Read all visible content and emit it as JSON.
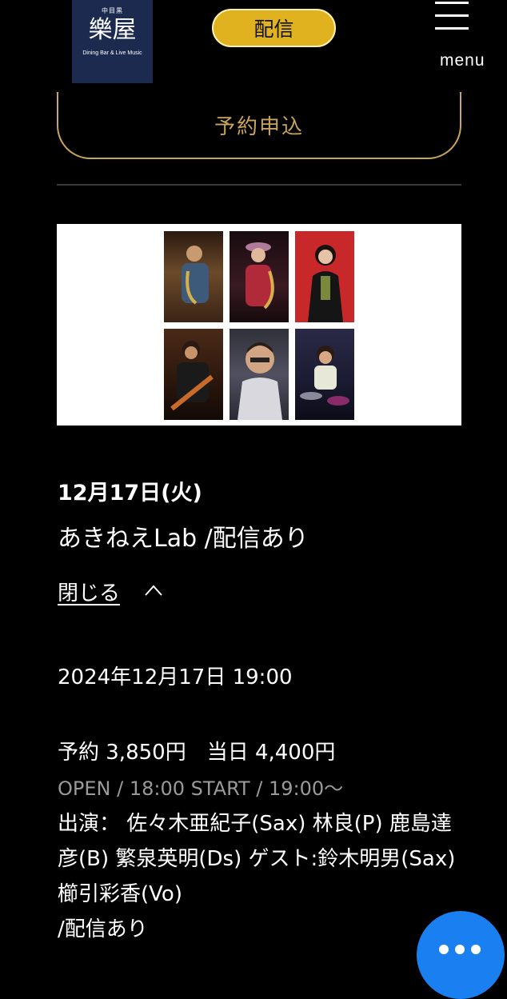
{
  "header": {
    "logo": {
      "small": "中目黒",
      "main": "樂屋",
      "subtitle": "Dining Bar & Live Music"
    },
    "stream_button_label": "配信",
    "menu_label": "menu"
  },
  "reserve_button_label": "予約申込",
  "event": {
    "date": "12月17日(火)",
    "title": "あきねえLab /配信あり",
    "close_label": "閉じる",
    "datetime": "2024年12月17日 19:00",
    "price": "予約 3,850円　当日 4,400円",
    "open_start": "OPEN / 18:00  START / 19:00〜",
    "performers": "出演： 佐々木亜紀子(Sax) 林良(P) 鹿島達彦(B) 繁泉英明(Ds) ゲスト:鈴木明男(Sax) 櫛引彩香(Vo)",
    "streaming_note": " /配信あり"
  },
  "colors": {
    "gold": "#c9a45c",
    "stream_yellow": "#e0b21f",
    "chat_blue": "#1a7ff0",
    "logo_navy": "#1b2a4e"
  },
  "icons": [
    "hamburger-menu-icon",
    "chevron-up-icon",
    "more-dots-icon"
  ]
}
